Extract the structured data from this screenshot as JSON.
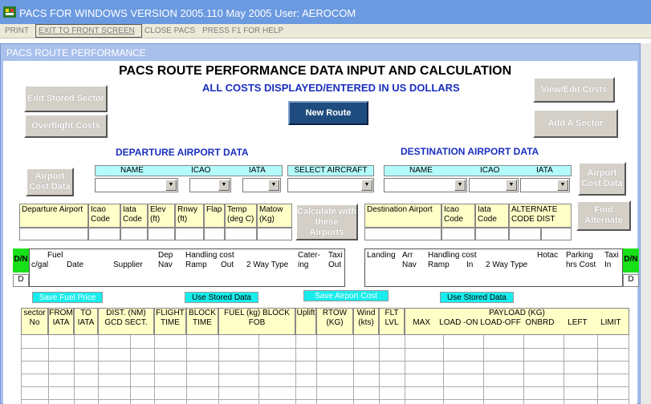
{
  "titlebar": {
    "title": "PACS  FOR WINDOWS  VERSION 2005.110 May 2005    User: AEROCOM"
  },
  "menu": {
    "print": "PRINT",
    "exit": "EXIT TO FRONT SCREEN",
    "close": "CLOSE PACS",
    "help": "PRESS F1 FOR HELP"
  },
  "panel": {
    "title": "PACS ROUTE PERFORMANCE"
  },
  "header": {
    "title": "PACS ROUTE PERFORMANCE DATA INPUT AND CALCULATION",
    "subtitle": "ALL COSTS DISPLAYED/ENTERED IN US DOLLARS"
  },
  "buttons": {
    "edit_sector": "Edit Stored Sector",
    "overflight": "Overflight Costs",
    "new_route": "New Route",
    "view_costs": "View/Edit Costs",
    "add_sector": "Add A Sector",
    "airport_cost_dep": "Airport Cost Data",
    "airport_cost_dest": "Airport Cost Data",
    "calc": "Calculate with these Airports",
    "find_alt": "Find Alternate",
    "save_fuel": "Save Fuel Price",
    "use_stored_1": "Use Stored Data",
    "save_airport": "Save Airport Cost",
    "use_stored_2": "Use Stored Data"
  },
  "departure": {
    "heading": "DEPARTURE AIRPORT DATA",
    "name": "NAME",
    "icao": "ICAO",
    "iata": "IATA"
  },
  "aircraft": {
    "heading": "SELECT AIRCRAFT"
  },
  "destination": {
    "heading": "DESTINATION AIRPORT DATA",
    "name": "NAME",
    "icao": "ICAO",
    "iata": "IATA"
  },
  "dep_table": {
    "dep_airport": "Departure Airport",
    "icao": "Icao Code",
    "iata": "Iata Code",
    "elev": "Elev (ft)",
    "rnwy": "Rnwy (ft)",
    "flap": "Flap",
    "temp": "Temp (deg C)",
    "matow": "Matow (Kg)"
  },
  "dest_table": {
    "dest_airport": "Destination Airport",
    "icao": "Icao Code",
    "iata": "Iata Code",
    "alt": "ALTERNATE CODE   DIST"
  },
  "cost_hdr": {
    "fuel": "Fuel",
    "cgal": "c/gal",
    "date": "Date",
    "supplier": "Supplier",
    "dep_nav": "Dep Nav",
    "handling": "Handling cost",
    "ramp": "Ramp",
    "out": "Out",
    "twoway": "2 Way Type",
    "catering": "Cater- ing",
    "taxi_out": "Taxi Out",
    "landing": "Landing",
    "arr_nav": "Arr Nav",
    "handling2": "Handling cost",
    "ramp2": "Ramp",
    "in": "In",
    "twoway2": "2 Way Type",
    "hotac": "Hotac",
    "parking": "Parking hrs Cost",
    "taxi_in": "Taxi In",
    "dn": "D/N",
    "d": "D"
  },
  "grid": {
    "sector": "sector No",
    "from": "FROM IATA",
    "to": "TO IATA",
    "dist": "DIST. (NM) GCD   SECT.",
    "flight": "FLIGHT TIME",
    "block": "BLOCK TIME",
    "fuel": "FUEL (kg) BLOCK        FOB",
    "uplift": "Uplift",
    "rtow": "RTOW (KG)",
    "wind": "Wind (kts)",
    "flt": "FLT LVL",
    "payload": "PAYLOAD (KG)",
    "payload_cols": "MAX    LOAD -ON LOAD-OFF  ONBRD      LEFT      LIMIT"
  }
}
